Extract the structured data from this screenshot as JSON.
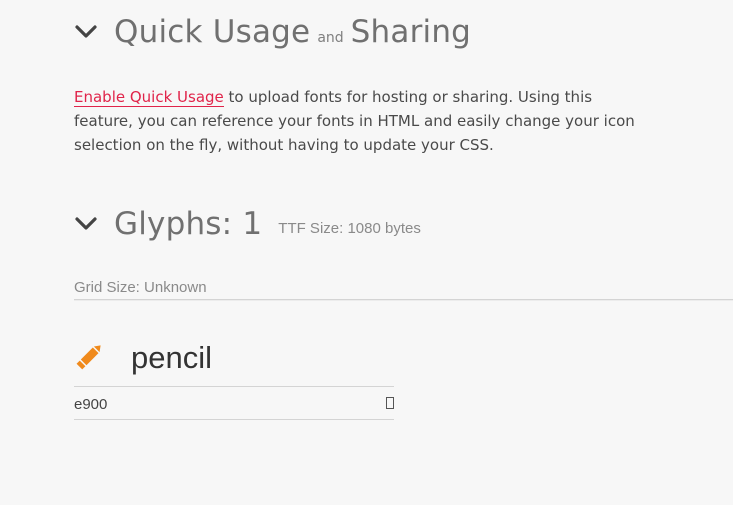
{
  "quick_usage": {
    "title_part1": "Quick Usage",
    "title_and": "and",
    "title_part2": "Sharing",
    "link_text": "Enable Quick Usage",
    "paragraph_text": " to upload fonts for hosting or sharing. Using this feature, you can reference your fonts in HTML and easily change your icon selection on the fly, without having to update your CSS.",
    "chevron_icon": "chevron-down-icon"
  },
  "glyphs": {
    "title": "Glyphs: 1",
    "ttf_size": "TTF Size: 1080 bytes",
    "grid_size": "Grid Size: Unknown",
    "chevron_icon": "chevron-down-icon",
    "items": [
      {
        "name": "pencil",
        "code": "e900",
        "icon": "pencil-icon",
        "icon_color": "#f08a1c"
      }
    ]
  },
  "colors": {
    "link": "#e0244a",
    "accent": "#f08a1c"
  }
}
